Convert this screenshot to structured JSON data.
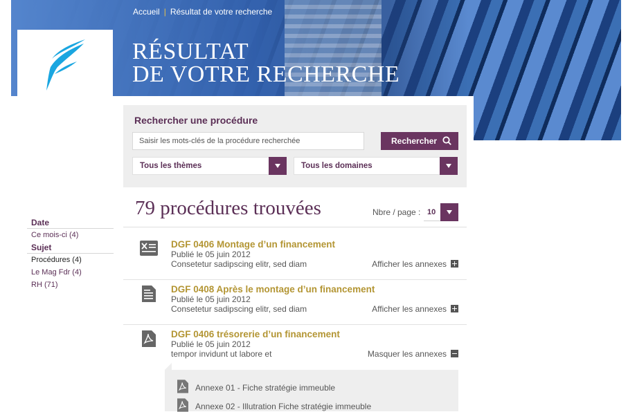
{
  "breadcrumb": {
    "home": "Accueil",
    "current": "Résultat de votre recherche"
  },
  "hero": {
    "title_line1": "RÉSULTAT",
    "title_line2": "DE VOTRE RECHERCHE"
  },
  "search": {
    "title": "Rechercher une procédure",
    "input_value": "Saisir les mots-clés de la procédure recherchée",
    "button_label": "Rechercher",
    "themes_select": "Tous les thèmes",
    "domains_select": "Tous les domaines"
  },
  "results_header": {
    "count_text": "79 procédures trouvées",
    "per_page_label": "Nbre / page :",
    "per_page_value": "10"
  },
  "filters": {
    "date_heading": "Date",
    "date_items": [
      "Ce mois-ci (4)"
    ],
    "subject_heading": "Sujet",
    "subject_items": [
      "Procédures (4)",
      "Le Mag Fdr (4)",
      "RH (71)"
    ]
  },
  "results": [
    {
      "title": "DGF 0406 Montage d’un financement",
      "date": "Publié le 05 juin 2012",
      "desc": "Consetetur sadipscing elitr, sed diam",
      "toggle": "Afficher les annexes",
      "icon": "excel-doc-icon"
    },
    {
      "title": "DGF 0408 Après le montage d’un financement",
      "date": "Publié le 05 juin 2012",
      "desc": "Consetetur sadipscing elitr, sed diam",
      "toggle": "Afficher les annexes",
      "icon": "word-doc-icon"
    },
    {
      "title": "DGF 0406 trésorerie d’un financement",
      "date": "Publié le 05 juin 2012",
      "desc": "tempor invidunt ut labore et",
      "toggle": "Masquer les annexes",
      "icon": "pdf-doc-icon"
    }
  ],
  "annexes": [
    {
      "label": "Annexe 01 - Fiche stratégie immeuble"
    },
    {
      "label": "Annexe 02 - Illutration Fiche stratégie immeuble"
    }
  ],
  "colors": {
    "brand_purple": "#6a3560",
    "title_gold": "#b39533",
    "heading_purple": "#5b2f56"
  }
}
